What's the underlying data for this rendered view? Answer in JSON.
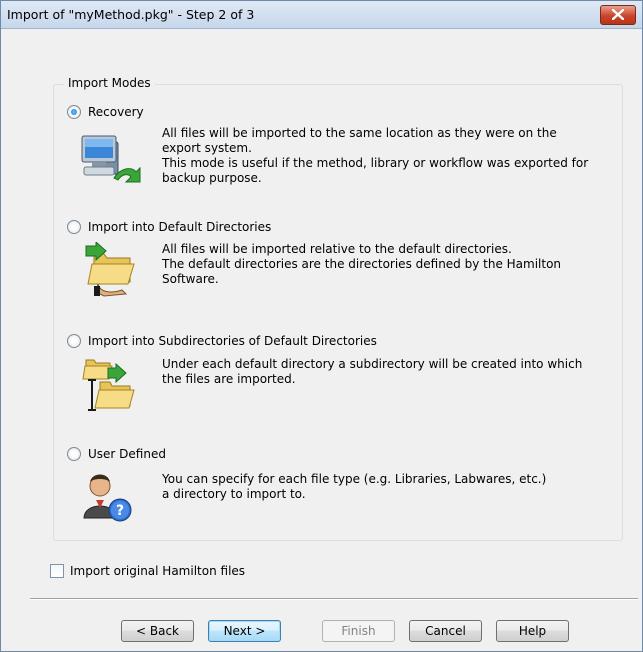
{
  "window": {
    "title": "Import of \"myMethod.pkg\" - Step 2 of 3",
    "close_glyph": "×"
  },
  "group": {
    "label": "Import Modes",
    "options": [
      {
        "label": "Recovery",
        "selected": true,
        "icon": "computer-recovery-icon",
        "description": [
          "All files will be imported to the same location as they were on the",
          "export system.",
          "This mode is useful if the method, library or workflow was exported for",
          "backup purpose."
        ]
      },
      {
        "label": "Import into Default Directories",
        "selected": false,
        "icon": "folder-import-icon",
        "description": [
          "All files will be imported relative to the default directories.",
          "The default directories are the directories defined by the Hamilton",
          "Software."
        ]
      },
      {
        "label": "Import into Subdirectories of Default Directories",
        "selected": false,
        "icon": "subfolder-import-icon",
        "description": [
          "Under each default directory a subdirectory will be created into which",
          "the files are imported."
        ]
      },
      {
        "label": "User Defined",
        "selected": false,
        "icon": "user-help-icon",
        "description": [
          "You can specify for each file type (e.g. Libraries, Labwares, etc.)",
          "a directory to import to."
        ]
      }
    ]
  },
  "checkbox": {
    "label": "Import original Hamilton files",
    "checked": false
  },
  "buttons": {
    "back": "< Back",
    "next": "Next >",
    "finish": "Finish",
    "cancel": "Cancel",
    "help": "Help"
  }
}
